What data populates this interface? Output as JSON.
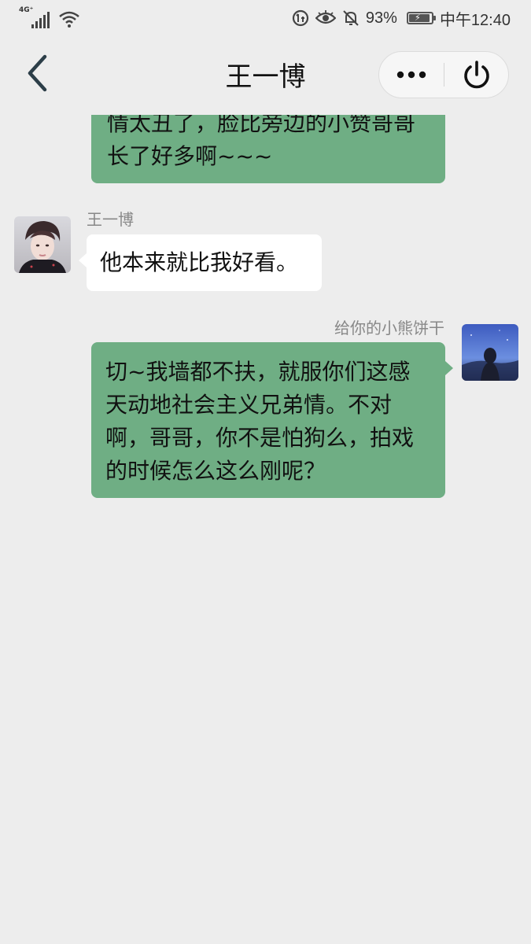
{
  "status_bar": {
    "network": "4G⁺",
    "battery_percent": "93%",
    "time": "中午12:40",
    "battery_level": 0.93
  },
  "header": {
    "title": "王一博"
  },
  "messages": [
    {
      "direction": "outgoing",
      "sender": "",
      "text": "情太丑了，脸比旁边的小赞哥哥长了好多啊~~~"
    },
    {
      "direction": "incoming",
      "sender": "王一博",
      "text": "他本来就比我好看。"
    },
    {
      "direction": "outgoing",
      "sender": "给你的小熊饼干",
      "text": "切~我墙都不扶，就服你们这感天动地社会主义兄弟情。不对啊，哥哥，你不是怕狗么，拍戏的时候怎么这么刚呢？"
    }
  ],
  "colors": {
    "background": "#ededed",
    "outgoing_bubble": "#6fae84",
    "incoming_bubble": "#ffffff"
  }
}
